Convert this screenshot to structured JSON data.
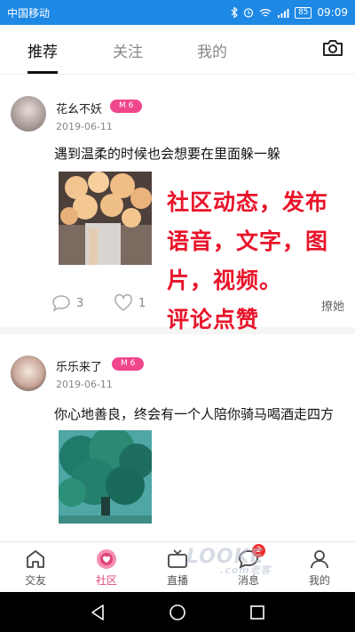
{
  "status_bar": {
    "carrier": "中国移动",
    "battery": "85",
    "time": "09:09"
  },
  "top_tabs": [
    {
      "label": "推荐",
      "active": true
    },
    {
      "label": "关注",
      "active": false
    },
    {
      "label": "我的",
      "active": false
    }
  ],
  "posts": [
    {
      "user": "花幺不妖",
      "level": "M 6",
      "date": "2019-06-11",
      "text": "遇到温柔的时候也会想要在里面躲一躲",
      "comments": "3",
      "likes": "1",
      "flirt_label": "撩她"
    },
    {
      "user": "乐乐来了",
      "level": "M 6",
      "date": "2019-06-11",
      "text": "你心地善良，终会有一个人陪你骑马喝酒走四方"
    }
  ],
  "overlay_lines": [
    "社区动态，发布",
    "语音，文字，图",
    "片，视频。",
    "评论点赞"
  ],
  "bottom_nav": [
    {
      "label": "交友",
      "icon": "home-icon",
      "active": false
    },
    {
      "label": "社区",
      "icon": "community-icon",
      "active": true
    },
    {
      "label": "直播",
      "icon": "tv-icon",
      "active": false
    },
    {
      "label": "消息",
      "icon": "message-icon",
      "active": false,
      "badge": "2"
    },
    {
      "label": "我的",
      "icon": "profile-icon",
      "active": false
    }
  ],
  "watermark": {
    "brand": "LOOKE",
    "sub": ".com老客"
  },
  "colors": {
    "status_bar": "#1e88e5",
    "accent_pink": "#e0457b",
    "badge_pink": "#f0468c",
    "overlay_red": "#e8142a"
  }
}
